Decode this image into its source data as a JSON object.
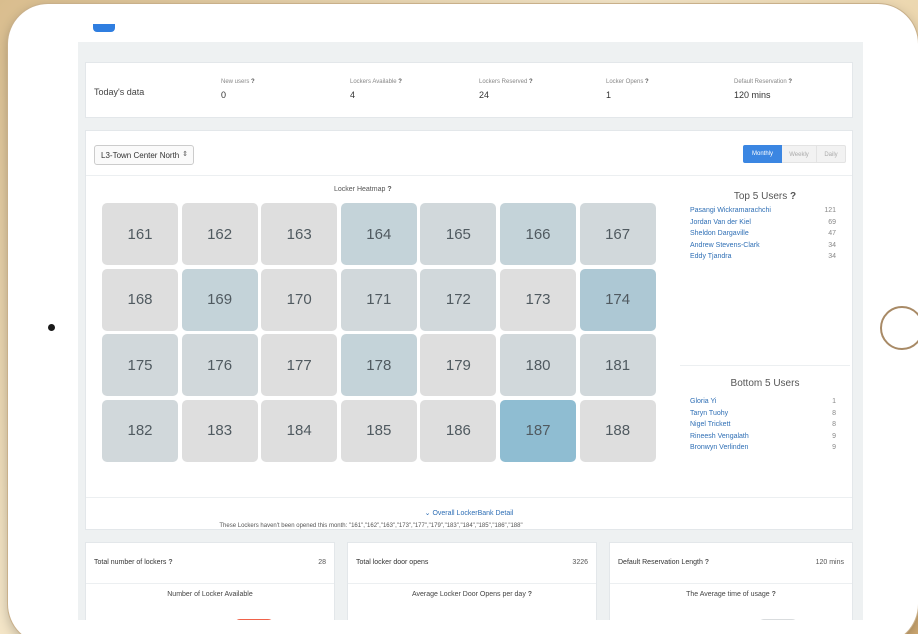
{
  "today": {
    "label": "Today's data",
    "stats": [
      {
        "title": "New users",
        "value": "0"
      },
      {
        "title": "Lockers Available",
        "value": "4"
      },
      {
        "title": "Lockers Reserved",
        "value": "24"
      },
      {
        "title": "Locker Opens",
        "value": "1"
      },
      {
        "title": "Default Reservation",
        "value": "120 mins"
      }
    ]
  },
  "controls": {
    "location": "L3-Town Center North",
    "periods": [
      "Monthly",
      "Weekly",
      "Daily"
    ],
    "active_period": "Monthly"
  },
  "heatmap": {
    "title": "Locker Heatmap",
    "columns": 7,
    "lockers": [
      {
        "id": "161",
        "level": 0
      },
      {
        "id": "162",
        "level": 0
      },
      {
        "id": "163",
        "level": 0
      },
      {
        "id": "164",
        "level": 2
      },
      {
        "id": "165",
        "level": 1
      },
      {
        "id": "166",
        "level": 2
      },
      {
        "id": "167",
        "level": 1
      },
      {
        "id": "168",
        "level": 0
      },
      {
        "id": "169",
        "level": 2
      },
      {
        "id": "170",
        "level": 0
      },
      {
        "id": "171",
        "level": 1
      },
      {
        "id": "172",
        "level": 1
      },
      {
        "id": "173",
        "level": 0
      },
      {
        "id": "174",
        "level": 3
      },
      {
        "id": "175",
        "level": 1
      },
      {
        "id": "176",
        "level": 1
      },
      {
        "id": "177",
        "level": 0
      },
      {
        "id": "178",
        "level": 2
      },
      {
        "id": "179",
        "level": 0
      },
      {
        "id": "180",
        "level": 1
      },
      {
        "id": "181",
        "level": 1
      },
      {
        "id": "182",
        "level": 1
      },
      {
        "id": "183",
        "level": 0
      },
      {
        "id": "184",
        "level": 0
      },
      {
        "id": "185",
        "level": 0
      },
      {
        "id": "186",
        "level": 0
      },
      {
        "id": "187",
        "level": 4
      },
      {
        "id": "188",
        "level": 0
      }
    ],
    "level_colors": [
      "#dedede",
      "#d1d8db",
      "#c4d3d9",
      "#adc8d4",
      "#8fbdd2"
    ],
    "note": "These Lockers haven't been opened this month: \"161\",\"162\",\"163\",\"173\",\"177\",\"179\",\"183\",\"184\",\"185\",\"186\",\"188\""
  },
  "top_users": {
    "title": "Top 5 Users",
    "rows": [
      {
        "name": "Pasangi Wickramarachchi",
        "count": "121"
      },
      {
        "name": "Jordan Van der Kiel",
        "count": "69"
      },
      {
        "name": "Sheldon Dargaville",
        "count": "47"
      },
      {
        "name": "Andrew Stevens-Clark",
        "count": "34"
      },
      {
        "name": "Eddy Tjandra",
        "count": "34"
      }
    ]
  },
  "bottom_users": {
    "title": "Bottom 5 Users",
    "rows": [
      {
        "name": "Gloria Yi",
        "count": "1"
      },
      {
        "name": "Taryn Tuohy",
        "count": "8"
      },
      {
        "name": "Nigel Trickett",
        "count": "8"
      },
      {
        "name": "Rineesh Vengalath",
        "count": "9"
      },
      {
        "name": "Bronwyn Verlinden",
        "count": "9"
      }
    ]
  },
  "overall_link": "Overall LockerBank Detail",
  "summary": [
    {
      "label": "Total number of lockers",
      "value": "28",
      "sub": "Number of Locker Available"
    },
    {
      "label": "Total locker door opens",
      "value": "3226",
      "sub": "Average Locker Door Opens per day"
    },
    {
      "label": "Default Reservation Length",
      "value": "120 mins",
      "sub": "The Average time of usage"
    }
  ],
  "colors": {
    "accent": "#3b86e2",
    "link": "#2f6fb5",
    "gauge": "#f0624a"
  }
}
